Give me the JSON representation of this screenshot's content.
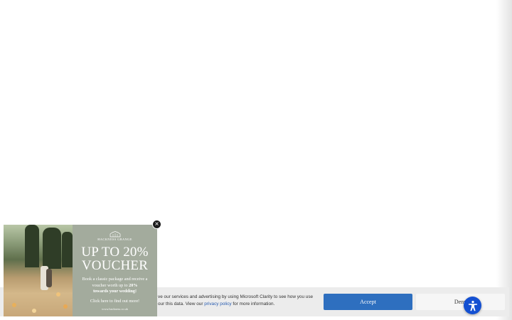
{
  "cookie_banner": {
    "text_before_link": "ve our services and advertising by using Microsoft Clarity to see how you use our this data. View our ",
    "link_text": "privacy policy",
    "text_after_link": " for more information.",
    "accept_label": "Accept",
    "deny_label": "Deny"
  },
  "popup": {
    "logo_text": "HACKNESS GRANGE",
    "headline_line1": "UP TO 20%",
    "headline_line2": "VOUCHER",
    "body_part1": "Book a classic package and receive a voucher worth up to ",
    "body_bold1": "20%",
    "body_bold2": "towards your wedding!",
    "cta": "Click here to find out more!",
    "url": "www.hackness.co.uk",
    "close_icon": "close-icon"
  },
  "colors": {
    "popup_bg": "#a3ab9d",
    "accept_bg": "#2e6fbf",
    "a11y_bg": "#1450d2"
  },
  "a11y": {
    "icon": "accessibility-icon"
  }
}
